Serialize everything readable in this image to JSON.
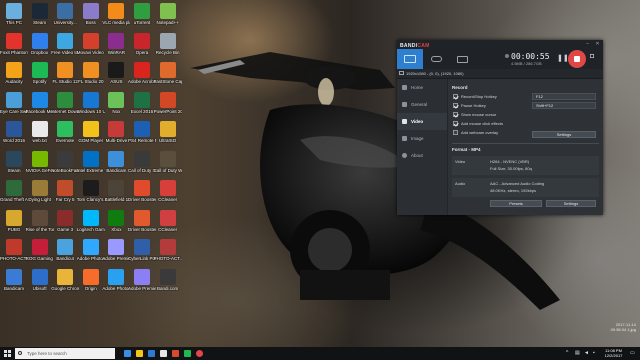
{
  "desktop": {
    "icons": [
      {
        "label": "This PC",
        "color": "#6ab0de"
      },
      {
        "label": "Steam",
        "color": "#1b2838"
      },
      {
        "label": "University...",
        "color": "#3a6ea5"
      },
      {
        "label": "Boss",
        "color": "#8a7ccb"
      },
      {
        "label": "VLC media player",
        "color": "#f28b1a"
      },
      {
        "label": "uTorrent",
        "color": "#2e9e3e"
      },
      {
        "label": "Notepad++",
        "color": "#7fc04e"
      },
      {
        "label": "Foxit PhantomPDF",
        "color": "#e2332c"
      },
      {
        "label": "Dropbox",
        "color": "#2f80ed"
      },
      {
        "label": "Free Video to MP3 Conv...",
        "color": "#3ca7e0"
      },
      {
        "label": "Movavi Video Suite 17",
        "color": "#d4402b"
      },
      {
        "label": "WinRAR",
        "color": "#8b2c8f"
      },
      {
        "label": "Opera",
        "color": "#c9252c"
      },
      {
        "label": "Recycle Bin",
        "color": "#9aa6b0"
      },
      {
        "label": "Audacity",
        "color": "#f3a21a"
      },
      {
        "label": "Spotify",
        "color": "#1db954"
      },
      {
        "label": "FL Studio 12",
        "color": "#f08f22"
      },
      {
        "label": "FL Studio 20",
        "color": "#f08f22"
      },
      {
        "label": "ASUS",
        "color": "#1a1a1a"
      },
      {
        "label": "Adobe Acrobat DC",
        "color": "#d9251d"
      },
      {
        "label": "FastStone Capture",
        "color": "#e06a2e"
      },
      {
        "label": "Eye Care Switcher",
        "color": "#4c9ed9"
      },
      {
        "label": "Facebook Messenger",
        "color": "#1e88e5"
      },
      {
        "label": "Internet Download...",
        "color": "#2c8d3c"
      },
      {
        "label": "Windows 10 Upgrade...",
        "color": "#1778d4"
      },
      {
        "label": "Nox",
        "color": "#6ac259"
      },
      {
        "label": "Excel 2016",
        "color": "#1e7145"
      },
      {
        "label": "PowerPoint 2016",
        "color": "#d24726"
      },
      {
        "label": "Word 2016",
        "color": "#2b579a"
      },
      {
        "label": "web.txt",
        "color": "#e9e9e9"
      },
      {
        "label": "Evernote",
        "color": "#2dbe60"
      },
      {
        "label": "GOM Player",
        "color": "#f3c21a"
      },
      {
        "label": "Multi-Drive",
        "color": "#c73a3a"
      },
      {
        "label": "PS4 Remote Play",
        "color": "#1d5fb3"
      },
      {
        "label": "UltraISO",
        "color": "#e0ae2c"
      },
      {
        "label": "Steam",
        "color": "#2a475e"
      },
      {
        "label": "NVIDIA GeForce...",
        "color": "#76b900"
      },
      {
        "label": "NoteBookFan...",
        "color": "#3b3b3b"
      },
      {
        "label": "Intel Extreme Tuning",
        "color": "#0071c5"
      },
      {
        "label": "Bandicam",
        "color": "#3c8fd8"
      },
      {
        "label": "Call of Duty Infinite...",
        "color": "#3a3a3a"
      },
      {
        "label": "Call of Duty WWII",
        "color": "#5a4e3c"
      },
      {
        "label": "Grand Theft Auto V",
        "color": "#2e6a3b"
      },
      {
        "label": "Dying Light",
        "color": "#9a7b38"
      },
      {
        "label": "Far Cry 5",
        "color": "#c14c2c"
      },
      {
        "label": "Tom Clancy's...",
        "color": "#1c1c1c"
      },
      {
        "label": "Battlefield 1",
        "color": "#4c4438"
      },
      {
        "label": "Driver Booster",
        "color": "#e04b2d"
      },
      {
        "label": "CCleaner",
        "color": "#d73f3a"
      },
      {
        "label": "PUBG",
        "color": "#d6a82e"
      },
      {
        "label": "Rise of the Tomb Raider",
        "color": "#5d4a3a"
      },
      {
        "label": "Game 3",
        "color": "#8a2c2c"
      },
      {
        "label": "Logitech Gaming",
        "color": "#00b8fc"
      },
      {
        "label": "Xbox",
        "color": "#107c10"
      },
      {
        "label": "Driver Booster 5",
        "color": "#e05a2d"
      },
      {
        "label": "CCleaner",
        "color": "#d04040"
      },
      {
        "label": "PHOTO-ACT...",
        "color": "#c03a2b"
      },
      {
        "label": "ROG Gaming Center",
        "color": "#c41e3a"
      },
      {
        "label": "Bandicut",
        "color": "#4aa3df"
      },
      {
        "label": "Adobe Photoshop",
        "color": "#31a8ff"
      },
      {
        "label": "Adobe Premiere",
        "color": "#9999ff"
      },
      {
        "label": "CyberLink PowerDVD",
        "color": "#2f5fa8"
      },
      {
        "label": "PHOTO-ACT...",
        "color": "#b33b3b"
      },
      {
        "label": "Bandicam",
        "color": "#3a7bd5"
      },
      {
        "label": "Ubisoft",
        "color": "#2c6ec9"
      },
      {
        "label": "Google Chrome",
        "color": "#e8b43a"
      },
      {
        "label": "Origin",
        "color": "#f56c2d"
      },
      {
        "label": "Adobe Photoshop",
        "color": "#2aa0f0"
      },
      {
        "label": "Adobe Premiere Pro",
        "color": "#8b7ff3"
      },
      {
        "label": "Bandi.com",
        "color": "#3a3a3a"
      }
    ],
    "watermark": {
      "line1": "2017-11-14",
      "line2": "09.58.04 1.jpg"
    }
  },
  "bandicam": {
    "logo_a": "BANDI",
    "logo_b": "CAM",
    "win_minimize": "–",
    "win_close": "✕",
    "timer": "00:00:55",
    "size": "4.5MB / 286.7GB",
    "pause_glyph": "❚❚",
    "camera_glyph": "◘",
    "target": "1920x1080 - (0, 0), (1920, 1080)",
    "nav": [
      {
        "label": "Home",
        "active": false
      },
      {
        "label": "General",
        "active": false
      },
      {
        "label": "Video",
        "active": true
      },
      {
        "label": "Image",
        "active": false
      },
      {
        "label": "About",
        "active": false
      }
    ],
    "record_title": "Record",
    "options": [
      {
        "label": "Record/Stop Hotkey",
        "checked": true
      },
      {
        "label": "Pause Hotkey",
        "checked": true
      },
      {
        "label": "Show mouse cursor",
        "checked": true
      },
      {
        "label": "Add mouse click effects",
        "checked": true
      },
      {
        "label": "Add webcam overlay",
        "checked": false
      }
    ],
    "hotkey_record": "F12",
    "hotkey_pause": "Shift+F12",
    "settings_label": "Settings",
    "format_title": "Format - MP4",
    "video_key": "Video",
    "video_line1": "H264 - NVENC (VBR)",
    "video_line2": "Full Size, 30.00fps, 80q",
    "audio_key": "Audio",
    "audio_line1": "AAC - Advanced Audio Coding",
    "audio_line2": "48.0KHz, stereo, 192kbps",
    "presets_label": "Presets",
    "settings2_label": "Settings"
  },
  "taskbar": {
    "search_placeholder": "Type here to search",
    "time": "11:08 PM",
    "date": "12/2/2017",
    "apps": [
      "#3a8ee6",
      "#f5c518",
      "#2b7bd0",
      "#e6e6e6",
      "#d64a2d",
      "#1db954",
      "#e04848"
    ]
  }
}
